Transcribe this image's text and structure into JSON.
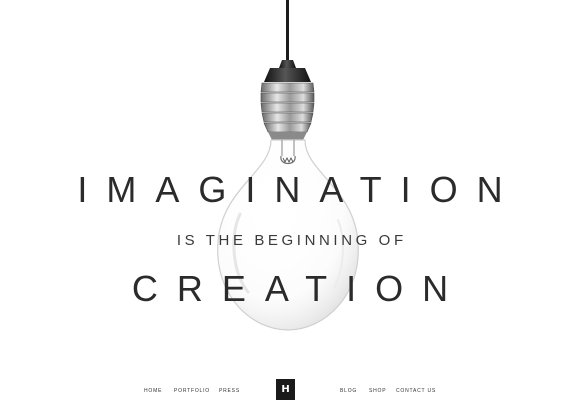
{
  "hero": {
    "line1": "IMAGINATION",
    "line2": "IS THE BEGINNING OF",
    "line3": "CREATION"
  },
  "nav": {
    "items_left": [
      "HOME",
      "PORTFOLIO",
      "PRESS"
    ],
    "logo": "H",
    "items_right": [
      "BLOG",
      "SHOP",
      "CONTACT US"
    ]
  },
  "colors": {
    "background": "#ffffff",
    "text": "#2b2b2b",
    "logo_bg": "#1a1a1a"
  },
  "icons": {
    "hero_image": "light-bulb-icon"
  }
}
